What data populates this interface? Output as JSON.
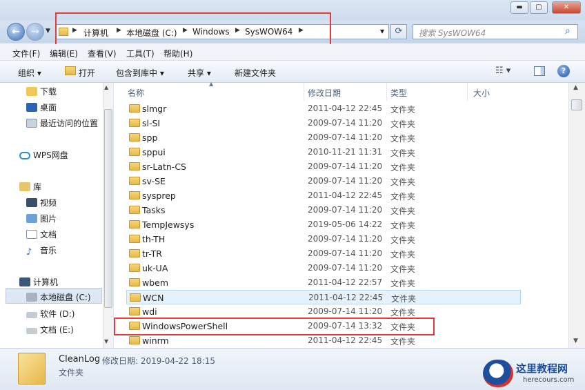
{
  "window": {
    "minimize": "▬",
    "maximize": "▢",
    "close": "✕"
  },
  "address": {
    "crumbs": [
      "计算机",
      "本地磁盘 (C:)",
      "Windows",
      "SysWOW64"
    ],
    "dropdown": "▾",
    "refresh": "⟳"
  },
  "search": {
    "placeholder": "搜索 SysWOW64",
    "icon": "search-icon"
  },
  "menu": [
    "文件(F)",
    "编辑(E)",
    "查看(V)",
    "工具(T)",
    "帮助(H)"
  ],
  "toolbar": {
    "organize": "组织 ▾",
    "open": "打开",
    "include_library": "包含到库中 ▾",
    "share": "共享 ▾",
    "new_folder": "新建文件夹"
  },
  "nav": {
    "downloads": "下载",
    "desktop": "桌面",
    "recent": "最近访问的位置",
    "wps": "WPS网盘",
    "libraries": "库",
    "videos": "视频",
    "pictures": "图片",
    "documents": "文档",
    "music": "音乐",
    "computer": "计算机",
    "local_c": "本地磁盘 (C:)",
    "soft_d": "软件 (D:)",
    "doc_e": "文档 (E:)"
  },
  "columns": {
    "name": "名称",
    "date": "修改日期",
    "type": "类型",
    "size": "大小"
  },
  "files": [
    {
      "name": "slmgr",
      "date": "2011-04-12 22:45",
      "type": "文件夹"
    },
    {
      "name": "sl-SI",
      "date": "2009-07-14 11:20",
      "type": "文件夹"
    },
    {
      "name": "spp",
      "date": "2009-07-14 11:20",
      "type": "文件夹"
    },
    {
      "name": "sppui",
      "date": "2010-11-21 11:31",
      "type": "文件夹"
    },
    {
      "name": "sr-Latn-CS",
      "date": "2009-07-14 11:20",
      "type": "文件夹"
    },
    {
      "name": "sv-SE",
      "date": "2009-07-14 11:20",
      "type": "文件夹"
    },
    {
      "name": "sysprep",
      "date": "2011-04-12 22:45",
      "type": "文件夹"
    },
    {
      "name": "Tasks",
      "date": "2009-07-14 11:20",
      "type": "文件夹"
    },
    {
      "name": "TempJewsys",
      "date": "2019-05-06 14:22",
      "type": "文件夹"
    },
    {
      "name": "th-TH",
      "date": "2009-07-14 11:20",
      "type": "文件夹"
    },
    {
      "name": "tr-TR",
      "date": "2009-07-14 11:20",
      "type": "文件夹"
    },
    {
      "name": "uk-UA",
      "date": "2009-07-14 11:20",
      "type": "文件夹"
    },
    {
      "name": "wbem",
      "date": "2011-04-12 22:57",
      "type": "文件夹"
    },
    {
      "name": "WCN",
      "date": "2011-04-12 22:45",
      "type": "文件夹"
    },
    {
      "name": "wdi",
      "date": "2009-07-14 11:20",
      "type": "文件夹"
    },
    {
      "name": "WindowsPowerShell",
      "date": "2009-07-14 13:32",
      "type": "文件夹"
    },
    {
      "name": "winrm",
      "date": "2011-04-12 22:45",
      "type": "文件夹"
    }
  ],
  "details": {
    "name": "CleanLog",
    "date_label": "修改日期: 2019-04-22 18:15",
    "type": "文件夹"
  },
  "watermark": {
    "title": "这里教程网",
    "url": "herecours.com"
  },
  "colors": {
    "highlight": "#e53a3a",
    "selected_row": "#e5f1fb"
  }
}
